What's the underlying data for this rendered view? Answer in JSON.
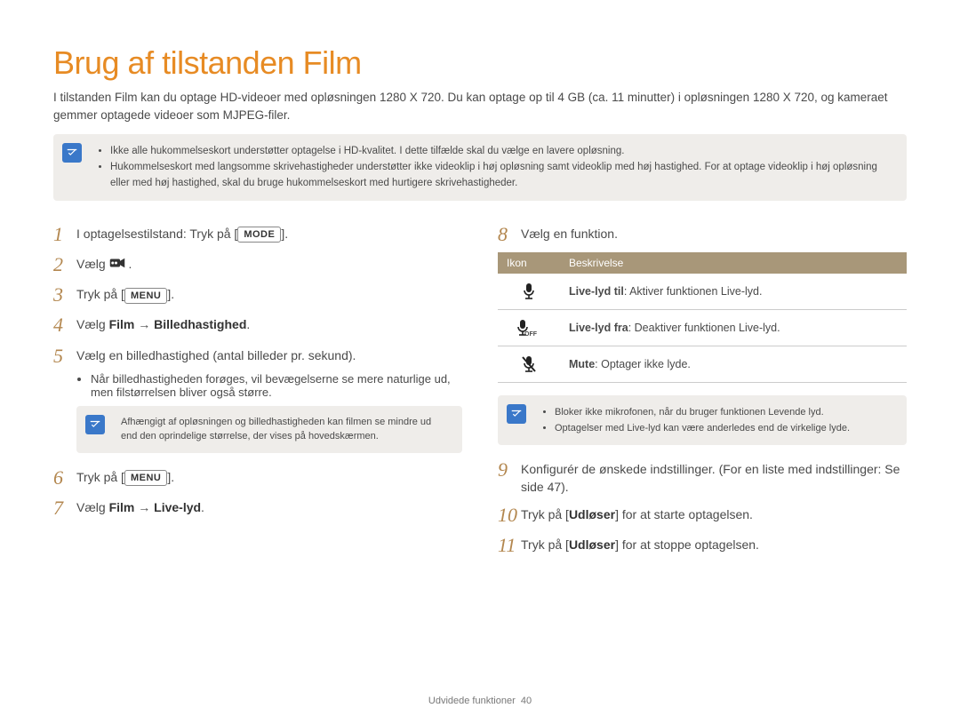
{
  "title": "Brug af tilstanden Film",
  "intro": "I tilstanden Film kan du optage HD-videoer med opløsningen 1280 X 720. Du kan optage op til 4 GB (ca. 11 minutter) i opløsningen 1280 X 720, og kameraet gemmer optagede videoer som MJPEG-filer.",
  "top_notes": [
    "Ikke alle hukommelseskort understøtter optagelse i HD-kvalitet. I dette tilfælde skal du vælge en lavere opløsning.",
    "Hukommelseskort med langsomme skrivehastigheder understøtter ikke videoklip i høj opløsning samt videoklip med høj hastighed. For at optage videoklip i høj opløsning eller med høj hastighed, skal du bruge hukommelseskort med hurtigere skrivehastigheder."
  ],
  "steps_left": {
    "s1_pre": "I optagelsestilstand: Tryk på [",
    "s1_key": "MODE",
    "s1_post": "].",
    "s2": "Vælg ",
    "s2_post": ".",
    "s3_pre": "Tryk på [",
    "s3_key": "MENU",
    "s3_post": "].",
    "s4_pre": "Vælg ",
    "s4_b1": "Film",
    "s4_arrow": " → ",
    "s4_b2": "Billedhastighed",
    "s4_post": ".",
    "s5": "Vælg en billedhastighed (antal billeder pr. sekund).",
    "s5_bullet": "Når billedhastigheden forøges, vil bevægelserne se mere naturlige ud, men filstørrelsen bliver også større.",
    "note5": "Afhængigt af opløsningen og billedhastigheden kan filmen se mindre ud end den oprindelige størrelse, der vises på hovedskærmen.",
    "s6_pre": "Tryk på [",
    "s6_key": "MENU",
    "s6_post": "].",
    "s7_pre": "Vælg ",
    "s7_b1": "Film",
    "s7_arrow": " → ",
    "s7_b2": "Live-lyd",
    "s7_post": "."
  },
  "steps_right": {
    "s8": "Vælg en funktion.",
    "table_head1": "Ikon",
    "table_head2": "Beskrivelse",
    "row1_b": "Live-lyd til",
    "row1_t": ": Aktiver funktionen Live-lyd.",
    "row2_b": "Live-lyd fra",
    "row2_t": ": Deaktiver funktionen Live-lyd.",
    "row3_b": "Mute",
    "row3_t": ": Optager ikke lyde.",
    "note8_a": "Bloker ikke mikrofonen, når du bruger funktionen Levende lyd.",
    "note8_b": "Optagelser med Live-lyd kan være anderledes end de virkelige lyde.",
    "s9": "Konfigurér de ønskede indstillinger. (For en liste med indstillinger: Se side 47).",
    "s10_pre": "Tryk på [",
    "s10_b": "Udløser",
    "s10_post": "] for at starte optagelsen.",
    "s11_pre": "Tryk på [",
    "s11_b": "Udløser",
    "s11_post": "] for at stoppe optagelsen."
  },
  "footer_section": "Udvidede funktioner",
  "footer_page": "40"
}
